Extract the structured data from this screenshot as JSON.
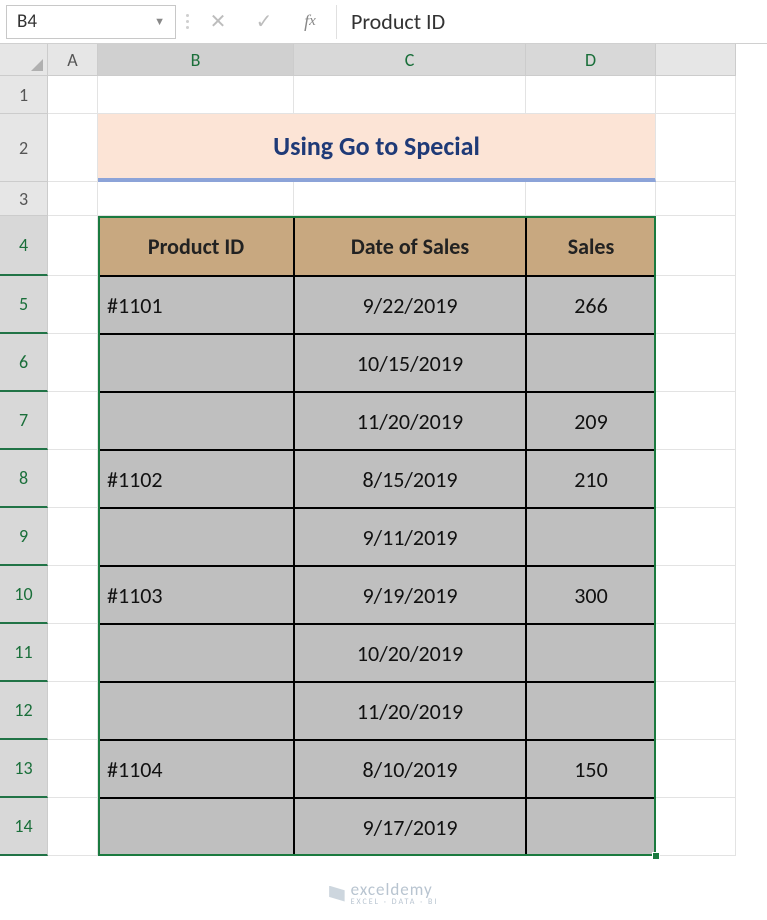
{
  "name_box": "B4",
  "formula_value": "Product ID",
  "columns": [
    "A",
    "B",
    "C",
    "D"
  ],
  "row_numbers": [
    "1",
    "2",
    "3",
    "4",
    "5",
    "6",
    "7",
    "8",
    "9",
    "10",
    "11",
    "12",
    "13",
    "14"
  ],
  "title": "Using Go to Special",
  "table": {
    "headers": [
      "Product ID",
      "Date of Sales",
      "Sales"
    ],
    "rows": [
      {
        "id": "#1101",
        "date": "9/22/2019",
        "sales": "266"
      },
      {
        "id": "",
        "date": "10/15/2019",
        "sales": ""
      },
      {
        "id": "",
        "date": "11/20/2019",
        "sales": "209"
      },
      {
        "id": "#1102",
        "date": "8/15/2019",
        "sales": "210"
      },
      {
        "id": "",
        "date": "9/11/2019",
        "sales": ""
      },
      {
        "id": "#1103",
        "date": "9/19/2019",
        "sales": "300"
      },
      {
        "id": "",
        "date": "10/20/2019",
        "sales": ""
      },
      {
        "id": "",
        "date": "11/20/2019",
        "sales": ""
      },
      {
        "id": "#1104",
        "date": "8/10/2019",
        "sales": "150"
      },
      {
        "id": "",
        "date": "9/17/2019",
        "sales": ""
      }
    ]
  },
  "watermark": {
    "brand": "exceldemy",
    "tagline": "EXCEL · DATA · BI"
  },
  "chart_data": {
    "type": "table",
    "title": "Using Go to Special",
    "columns": [
      "Product ID",
      "Date of Sales",
      "Sales"
    ],
    "rows": [
      [
        "#1101",
        "9/22/2019",
        266
      ],
      [
        "",
        "10/15/2019",
        null
      ],
      [
        "",
        "11/20/2019",
        209
      ],
      [
        "#1102",
        "8/15/2019",
        210
      ],
      [
        "",
        "9/11/2019",
        null
      ],
      [
        "#1103",
        "9/19/2019",
        300
      ],
      [
        "",
        "10/20/2019",
        null
      ],
      [
        "",
        "11/20/2019",
        null
      ],
      [
        "#1104",
        "8/10/2019",
        150
      ],
      [
        "",
        "9/17/2019",
        null
      ]
    ]
  }
}
